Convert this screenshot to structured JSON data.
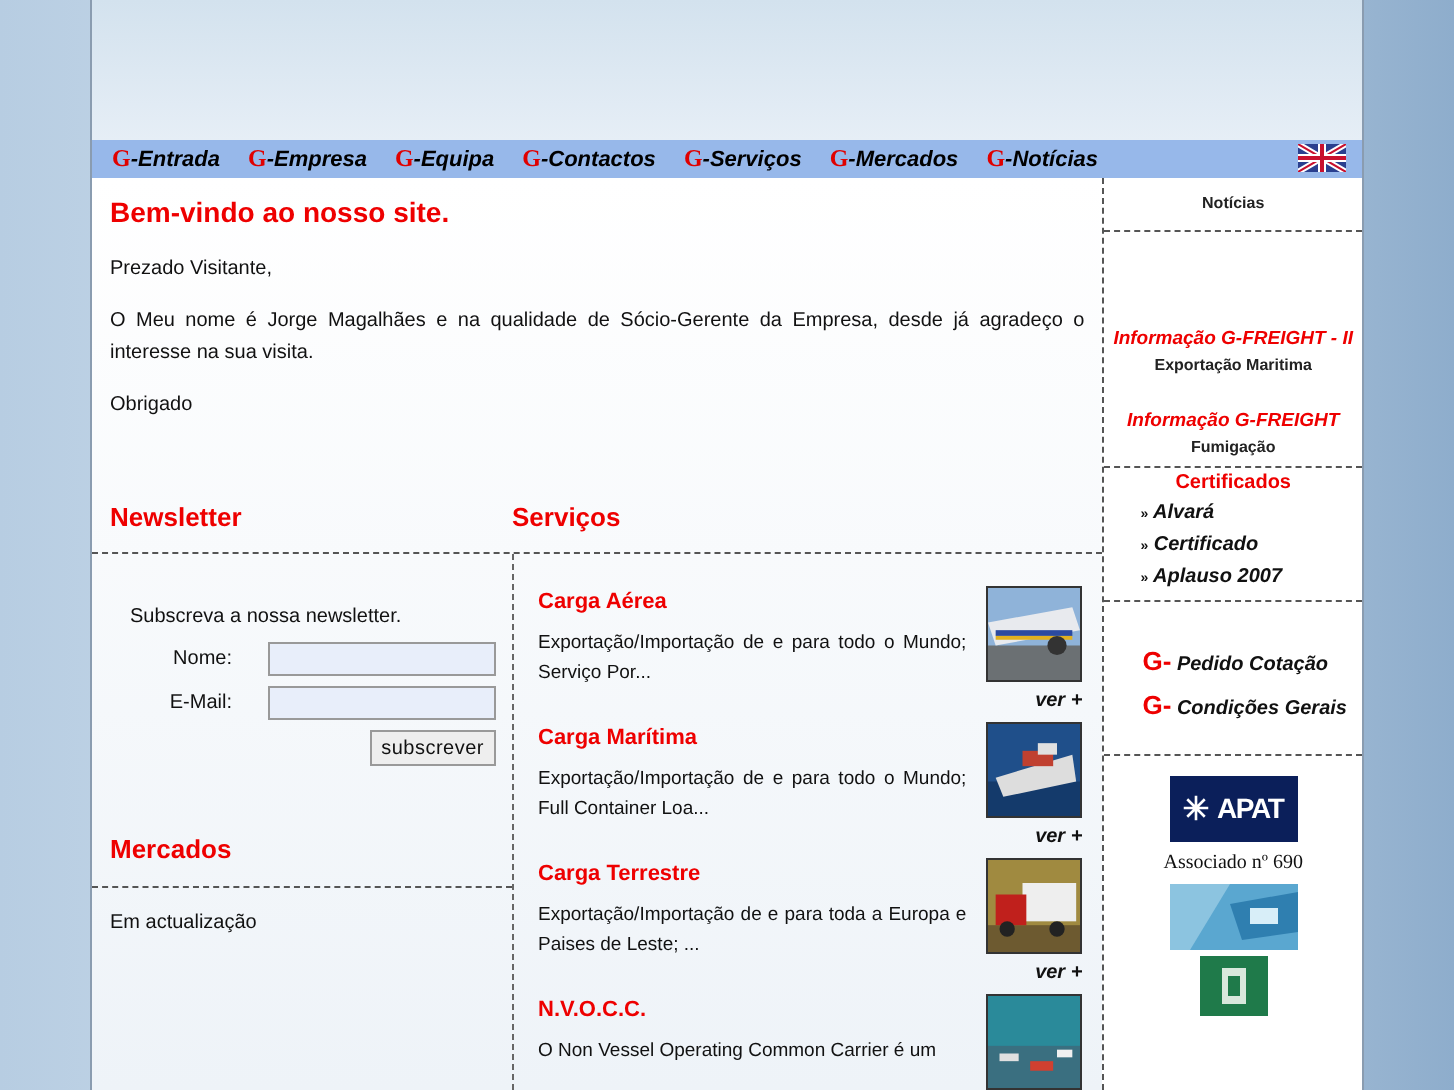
{
  "nav": {
    "items": [
      {
        "prefix": "G",
        "label": "-Entrada"
      },
      {
        "prefix": "G",
        "label": "-Empresa"
      },
      {
        "prefix": "G",
        "label": "-Equipa"
      },
      {
        "prefix": "G",
        "label": "-Contactos"
      },
      {
        "prefix": "G",
        "label": "-Serviços"
      },
      {
        "prefix": "G",
        "label": "-Mercados"
      },
      {
        "prefix": "G",
        "label": "-Notícias"
      }
    ]
  },
  "welcome": {
    "title": "Bem-vindo ao nosso site.",
    "paragraphs": [
      "Prezado Visitante,",
      "O Meu nome é Jorge Magalhães e na qualidade de Sócio-Gerente da Empresa, desde já agradeço o interesse na sua visita.",
      "Obrigado"
    ]
  },
  "newsletter": {
    "title": "Newsletter",
    "intro": "Subscreva a nossa newsletter.",
    "fields": [
      {
        "label": "Nome:"
      },
      {
        "label": "E-Mail:"
      }
    ],
    "button": "subscrever"
  },
  "mercados": {
    "title": "Mercados",
    "text": "Em actualização"
  },
  "servicos": {
    "title": "Serviços",
    "items": [
      {
        "title": "Carga Aérea",
        "text": "Exportação/Importação de e para todo o Mundo; Serviço Por...",
        "more": "ver +"
      },
      {
        "title": "Carga Marítima",
        "text": "Exportação/Importação de e para todo o Mundo; Full Container Loa...",
        "more": "ver +"
      },
      {
        "title": "Carga Terrestre",
        "text": "Exportação/Importação de e para toda a Europa e Paises de Leste; ...",
        "more": "ver +"
      },
      {
        "title": "N.V.O.C.C.",
        "text": "O Non Vessel Operating Common Carrier é um"
      }
    ]
  },
  "sidebar": {
    "news_title": "Notícias",
    "news": [
      {
        "title": "Informação G-FREIGHT - II",
        "subtitle": "Exportação Maritima"
      },
      {
        "title": "Informação G-FREIGHT",
        "subtitle": "Fumigação"
      }
    ],
    "certificates": {
      "title": "Certificados",
      "bullet": "»",
      "items": [
        "Alvará",
        "Certificado",
        "Aplauso 2007"
      ]
    },
    "links": [
      {
        "prefix": "G-",
        "label": "Pedido Cotação"
      },
      {
        "prefix": "G-",
        "label": "Condições Gerais"
      }
    ],
    "apat": {
      "logo": "APAT",
      "caption": "Associado nº 690"
    }
  }
}
